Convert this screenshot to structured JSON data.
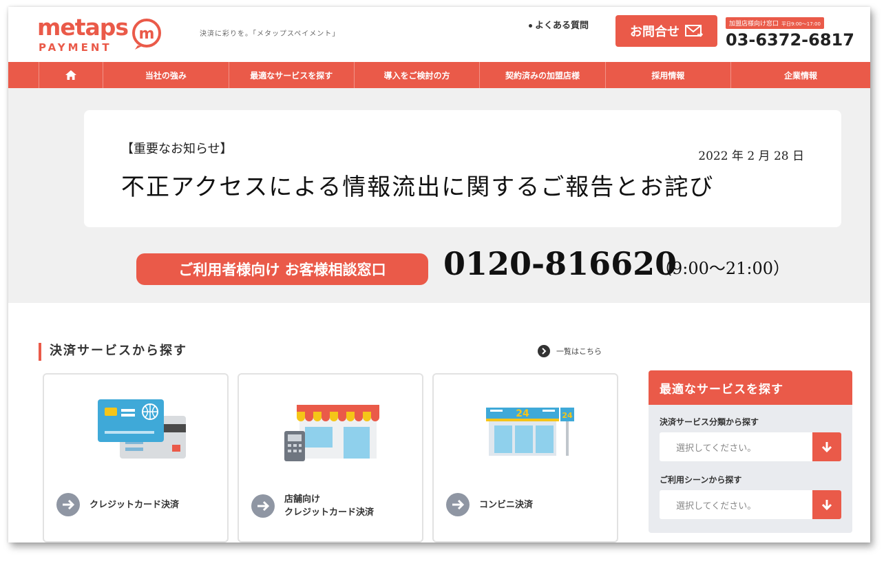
{
  "header": {
    "logo_text": "metaps",
    "logo_sub": "PAYMENT",
    "tagline": "決済に彩りを。「メタップスペイメント」",
    "faq_label": "よくある質問",
    "contact_label": "お問合せ",
    "phone_label": "加盟店様向け窓口",
    "phone_hours": "平日9:00〜17:00",
    "phone_number": "03-6372-6817"
  },
  "nav": {
    "items": [
      {
        "label": "当社の強み"
      },
      {
        "label": "最適なサービスを探す"
      },
      {
        "label": "導入をご検討の方"
      },
      {
        "label": "契約済みの加盟店様"
      },
      {
        "label": "採用情報"
      },
      {
        "label": "企業情報"
      }
    ]
  },
  "notice": {
    "tag": "【重要なお知らせ】",
    "date": "2022 年 2 月 28 日",
    "title": "不正アクセスによる情報流出に関するご報告とお詫び"
  },
  "support": {
    "button_label": "ご利用者様向け お客様相談窓口",
    "phone": "0120-816620",
    "hours": "（9:00〜21:00）"
  },
  "services": {
    "title": "決済サービスから探す",
    "view_all": "一覧はこちら",
    "cards": [
      {
        "label_line1": "クレジットカード決済",
        "label_line2": "",
        "icon": "credit-card-icon"
      },
      {
        "label_line1": "店舗向け",
        "label_line2": "クレジットカード決済",
        "icon": "store-icon"
      },
      {
        "label_line1": "コンビニ決済",
        "label_line2": "",
        "icon": "convenience-store-icon"
      }
    ]
  },
  "side_panel": {
    "title": "最適なサービスを探す",
    "filter1_label": "決済サービス分類から探す",
    "filter1_value": "選択してください。",
    "filter2_label": "ご利用シーンから探す",
    "filter2_value": "選択してください。"
  },
  "colors": {
    "accent": "#ea5a49",
    "hero_bg": "#f0f0f0",
    "panel_bg": "#e9ebef"
  }
}
